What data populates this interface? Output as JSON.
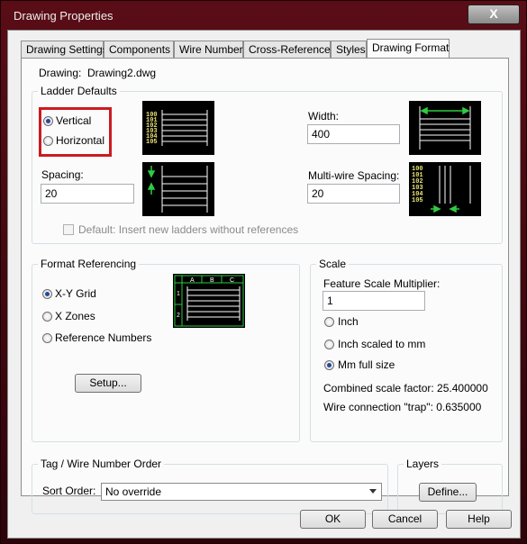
{
  "window": {
    "title": "Drawing Properties",
    "close_label": "X"
  },
  "tabs": [
    {
      "label": "Drawing Settings"
    },
    {
      "label": "Components"
    },
    {
      "label": "Wire Numbers"
    },
    {
      "label": "Cross-References"
    },
    {
      "label": "Styles"
    },
    {
      "label": "Drawing Format"
    }
  ],
  "drawing": {
    "label": "Drawing:",
    "value": "Drawing2.dwg"
  },
  "ladder": {
    "title": "Ladder Defaults",
    "vertical": "Vertical",
    "horizontal": "Horizontal",
    "selected": "Vertical",
    "width_label": "Width:",
    "width_value": "400",
    "spacing_label": "Spacing:",
    "spacing_value": "20",
    "multiwire_label": "Multi-wire Spacing:",
    "multiwire_value": "20",
    "default_checkbox": "Default: Insert new ladders without references",
    "preview_numbers": [
      "100",
      "101",
      "102",
      "103",
      "104",
      "105"
    ]
  },
  "format_ref": {
    "title": "Format Referencing",
    "xy": "X-Y Grid",
    "zones": "X Zones",
    "refnum": "Reference Numbers",
    "selected": "X-Y Grid",
    "setup": "Setup...",
    "preview_cols": [
      "A",
      "B",
      "C"
    ],
    "preview_rows": [
      "1",
      "2"
    ]
  },
  "scale": {
    "title": "Scale",
    "multiplier_label": "Feature Scale Multiplier:",
    "multiplier_value": "1",
    "inch": "Inch",
    "inch_mm": "Inch scaled to mm",
    "mm_full": "Mm full size",
    "selected": "Mm full size",
    "combined": "Combined scale factor: 25.400000",
    "trap": "Wire connection \"trap\": 0.635000"
  },
  "tag": {
    "title": "Tag / Wire Number Order",
    "sort_label": "Sort Order:",
    "sort_value": "No override"
  },
  "layers": {
    "title": "Layers",
    "define": "Define..."
  },
  "buttons": {
    "ok": "OK",
    "cancel": "Cancel",
    "help": "Help"
  },
  "colors": {
    "highlight": "#cc1a22",
    "preview_text": "#e8e076",
    "preview_arrow": "#2ecc40"
  }
}
